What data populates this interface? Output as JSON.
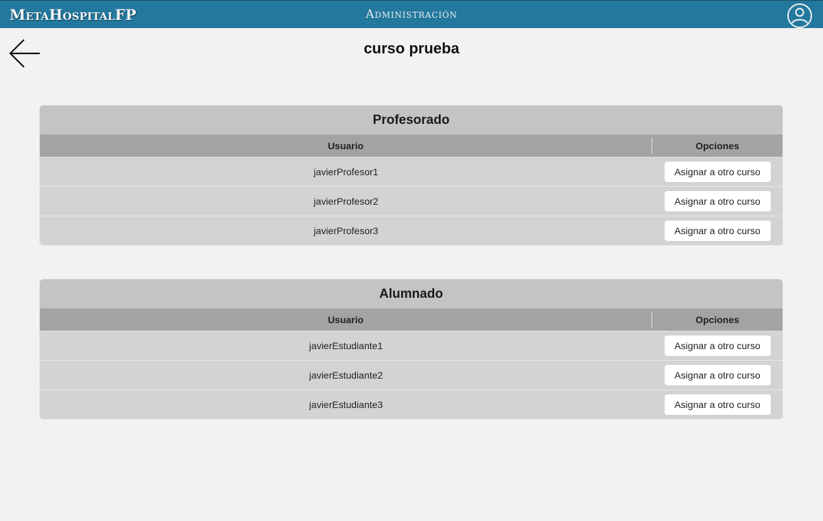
{
  "topbar": {
    "brand": "MetaHospitalFP",
    "section": "Administración",
    "profile_icon": "user-circle-icon",
    "color": "#23789d"
  },
  "page": {
    "title": "curso prueba",
    "back_icon": "arrow-left-icon"
  },
  "panels": [
    {
      "title": "Profesorado",
      "columns": {
        "user": "Usuario",
        "options": "Opciones"
      },
      "rows": [
        {
          "user": "javierProfesor1",
          "action": "Asignar a otro curso"
        },
        {
          "user": "javierProfesor2",
          "action": "Asignar a otro curso"
        },
        {
          "user": "javierProfesor3",
          "action": "Asignar a otro curso"
        }
      ]
    },
    {
      "title": "Alumnado",
      "columns": {
        "user": "Usuario",
        "options": "Opciones"
      },
      "rows": [
        {
          "user": "javierEstudiante1",
          "action": "Asignar a otro curso"
        },
        {
          "user": "javierEstudiante2",
          "action": "Asignar a otro curso"
        },
        {
          "user": "javierEstudiante3",
          "action": "Asignar a otro curso"
        }
      ]
    }
  ]
}
